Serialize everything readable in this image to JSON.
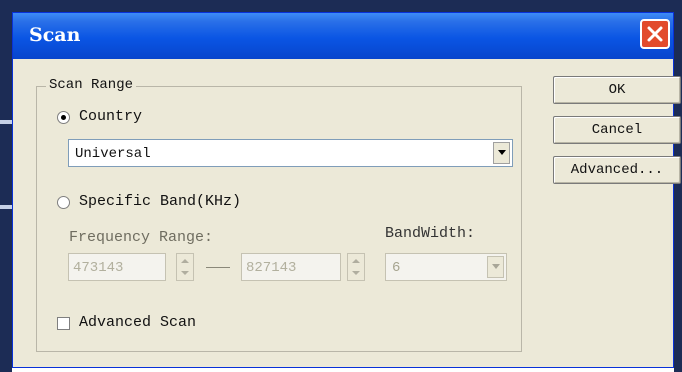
{
  "window": {
    "title": "Scan"
  },
  "scan_range": {
    "legend": "Scan Range",
    "country": {
      "label": "Country",
      "selected": true,
      "dropdown_value": "Universal"
    },
    "specific_band": {
      "label": "Specific Band(KHz)",
      "selected": false,
      "frequency_range_label": "Frequency Range:",
      "frequency_from": "473143",
      "frequency_to": "827143",
      "bandwidth_label": "BandWidth:",
      "bandwidth_value": "6"
    },
    "advanced_scan": {
      "label": "Advanced Scan",
      "checked": false
    }
  },
  "buttons": {
    "ok": "OK",
    "cancel": "Cancel",
    "advanced": "Advanced..."
  },
  "colors": {
    "titlebar": "#0a55e4",
    "close_button": "#e24b2c",
    "dialog_face": "#ece9d8"
  }
}
